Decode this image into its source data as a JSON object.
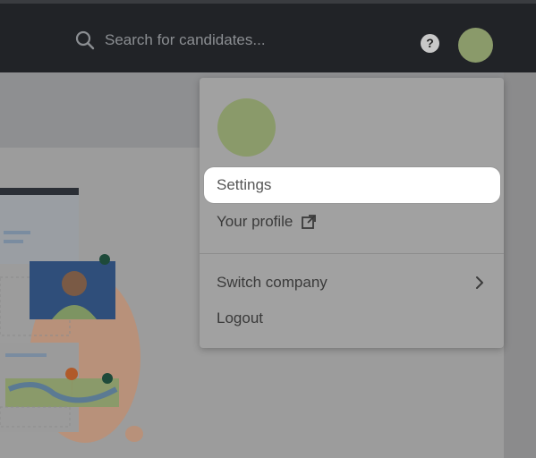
{
  "header": {
    "search_placeholder": "Search for candidates...",
    "help_icon": "question-circle-icon",
    "help_label": "?"
  },
  "menu": {
    "settings_label": "Settings",
    "profile_label": "Your profile",
    "switch_company_label": "Switch company",
    "logout_label": "Logout"
  },
  "colors": {
    "header_bg": "#212327",
    "avatar": "#8a9a6a",
    "highlight": "#ffffff",
    "illustration_accent": "#e9a57a"
  }
}
